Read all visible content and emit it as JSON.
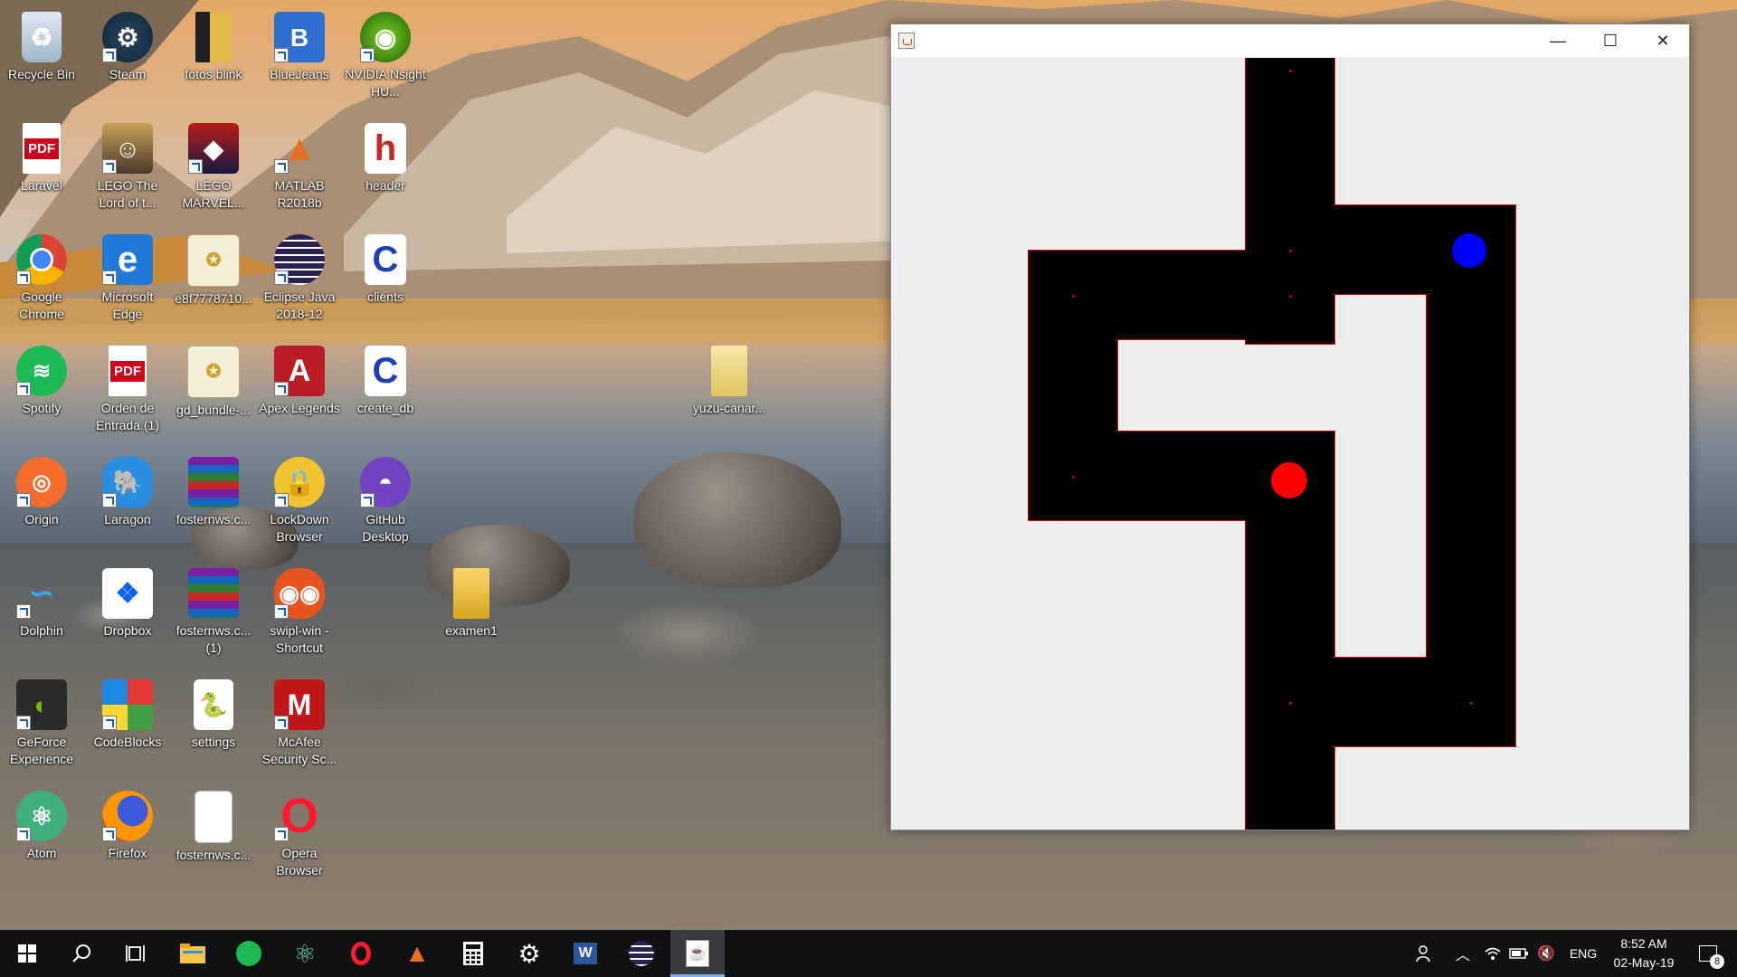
{
  "desktop": {
    "icons": [
      {
        "label": "Recycle Bin",
        "icon": "recycle-bin-icon"
      },
      {
        "label": "Steam",
        "icon": "steam-icon"
      },
      {
        "label": "fotos blink",
        "icon": "folder-icon"
      },
      {
        "label": "BlueJeans",
        "icon": "bluejeans-icon"
      },
      {
        "label": "NVIDIA Nsight HU...",
        "icon": "nvidia-nsight-icon"
      },
      {
        "label": "Laravel",
        "icon": "pdf-icon"
      },
      {
        "label": "LEGO The Lord of t...",
        "icon": "lego-lotr-icon"
      },
      {
        "label": "LEGO MARVEL...",
        "icon": "lego-marvel-icon"
      },
      {
        "label": "MATLAB R2018b",
        "icon": "matlab-icon"
      },
      {
        "label": "header",
        "icon": "header-file-icon"
      },
      {
        "label": "Google Chrome",
        "icon": "chrome-icon"
      },
      {
        "label": "Microsoft Edge",
        "icon": "edge-icon"
      },
      {
        "label": "e8f7778710...",
        "icon": "certificate-icon"
      },
      {
        "label": "Eclipse Java 2018-12",
        "icon": "eclipse-icon"
      },
      {
        "label": "clients",
        "icon": "c-file-icon"
      },
      {
        "label": "Spotify",
        "icon": "spotify-icon"
      },
      {
        "label": "Orden de Entrada (1)",
        "icon": "pdf-icon"
      },
      {
        "label": "gd_bundle-...",
        "icon": "certificate-icon"
      },
      {
        "label": "Apex Legends",
        "icon": "apex-icon"
      },
      {
        "label": "create_db",
        "icon": "c-file-icon"
      },
      {
        "label": "Origin",
        "icon": "origin-icon"
      },
      {
        "label": "Laragon",
        "icon": "laragon-icon"
      },
      {
        "label": "fosternws.c...",
        "icon": "winrar-icon"
      },
      {
        "label": "LockDown Browser",
        "icon": "lockdown-icon"
      },
      {
        "label": "GitHub Desktop",
        "icon": "github-icon"
      },
      {
        "label": "Dolphin",
        "icon": "dolphin-icon"
      },
      {
        "label": "Dropbox",
        "icon": "dropbox-icon"
      },
      {
        "label": "fosternws.c... (1)",
        "icon": "winrar-icon"
      },
      {
        "label": "swipl-win - Shortcut",
        "icon": "swipl-owl-icon"
      },
      {
        "label": "GeForce Experience",
        "icon": "geforce-icon"
      },
      {
        "label": "CodeBlocks",
        "icon": "codeblocks-icon"
      },
      {
        "label": "settings",
        "icon": "python-file-icon"
      },
      {
        "label": "McAfee Security Sc...",
        "icon": "mcafee-icon"
      },
      {
        "label": "Atom",
        "icon": "atom-icon"
      },
      {
        "label": "Firefox",
        "icon": "firefox-icon"
      },
      {
        "label": "fosternws.c...",
        "icon": "blank-file-icon"
      },
      {
        "label": "Opera Browser",
        "icon": "opera-icon"
      },
      {
        "label": "yuzu-canar...",
        "icon": "folder-icon"
      },
      {
        "label": "examen1",
        "icon": "folder-icon"
      }
    ]
  },
  "window": {
    "title": "",
    "controls": {
      "minimize": "—",
      "maximize": "☐",
      "close": "✕"
    },
    "player_color": "#0000ff",
    "enemy_color": "#ff0000",
    "path_color": "#000000",
    "edge_color": "#d40000"
  },
  "taskbar": {
    "pinned": [
      {
        "name": "start",
        "icon": "windows-start-icon",
        "active": false
      },
      {
        "name": "search",
        "icon": "search-icon",
        "active": false
      },
      {
        "name": "task-view",
        "icon": "task-view-icon",
        "active": false
      },
      {
        "name": "file-explorer",
        "icon": "file-explorer-icon",
        "active": false
      },
      {
        "name": "spotify",
        "icon": "spotify-icon",
        "active": false
      },
      {
        "name": "atom",
        "icon": "atom-icon",
        "active": false
      },
      {
        "name": "opera",
        "icon": "opera-icon",
        "active": false
      },
      {
        "name": "matlab",
        "icon": "matlab-icon",
        "active": false
      },
      {
        "name": "calculator",
        "icon": "calculator-icon",
        "active": false
      },
      {
        "name": "settings",
        "icon": "gear-icon",
        "active": false
      },
      {
        "name": "word",
        "icon": "word-icon",
        "active": false
      },
      {
        "name": "eclipse",
        "icon": "eclipse-icon",
        "active": false
      },
      {
        "name": "java",
        "icon": "java-icon",
        "active": true
      }
    ],
    "tray": {
      "language": "ENG",
      "time": "8:52 AM",
      "date": "02-May-19",
      "notification_count": "8"
    }
  }
}
